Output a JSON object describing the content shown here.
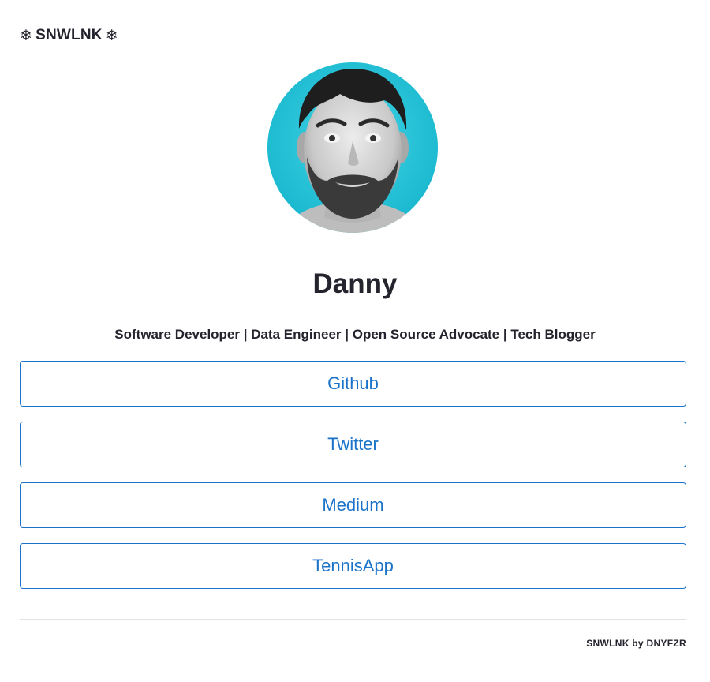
{
  "brand": {
    "icon": "snowflake-icon",
    "icon_glyph": "❄",
    "name": "SNWLNK"
  },
  "profile": {
    "name": "Danny",
    "tagline": "Software Developer | Data Engineer | Open Source Advocate | Tech Blogger",
    "avatar_bg": "#1fc2d8"
  },
  "links": [
    {
      "label": "Github"
    },
    {
      "label": "Twitter"
    },
    {
      "label": "Medium"
    },
    {
      "label": "TennisApp"
    }
  ],
  "footer": {
    "text": "SNWLNK by DNYFZR"
  },
  "colors": {
    "accent": "#1a73c9",
    "text": "#24242e",
    "divider": "#e2e2e2"
  }
}
